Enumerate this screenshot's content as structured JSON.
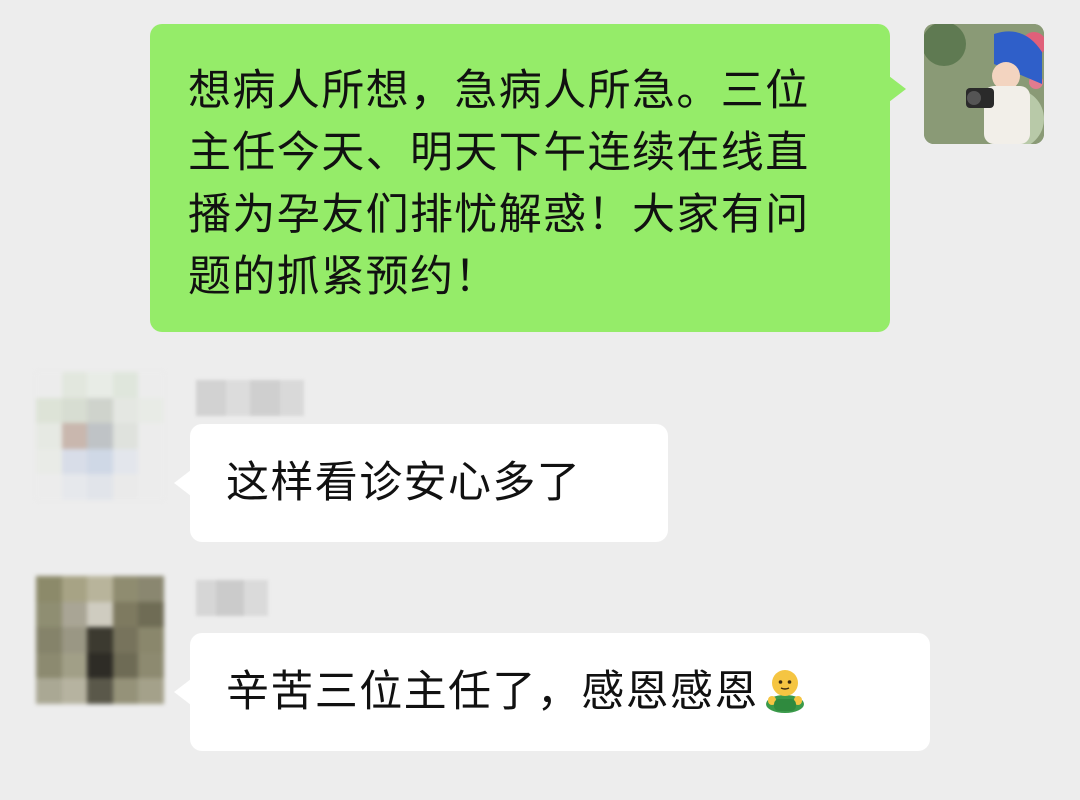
{
  "messages": [
    {
      "sender": "self",
      "text": "想病人所想，急病人所急。三位主任今天、明天下午连续在线直播为孕友们排忧解惑！大家有问题的抓紧预约！"
    },
    {
      "sender": "other",
      "text": "这样看诊安心多了"
    },
    {
      "sender": "other",
      "text": "辛苦三位主任了，感恩感恩",
      "emoji": "person-raising-hands-emoji"
    }
  ],
  "colors": {
    "background": "#ededed",
    "self_bubble": "#95ec69",
    "other_bubble": "#ffffff",
    "text": "#111111"
  },
  "icons": {
    "self_avatar": "photographer-avatar",
    "blurred_avatar": "pixelated-avatar",
    "blurred_name": "pixelated-name"
  }
}
